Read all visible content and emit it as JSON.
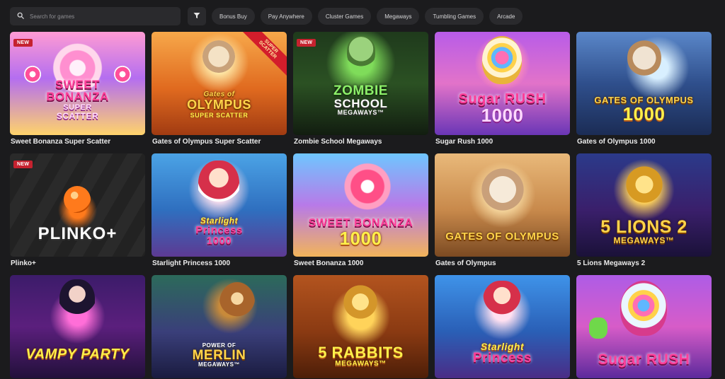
{
  "search": {
    "placeholder": "Search for games",
    "icon": "search-icon"
  },
  "filter": {
    "icon": "filter-icon"
  },
  "categories": [
    "Bonus Buy",
    "Pay Anywhere",
    "Cluster Games",
    "Megaways",
    "Tumbling Games",
    "Arcade"
  ],
  "games": [
    {
      "title": "Sweet Bonanza Super Scatter",
      "badge": "NEW",
      "logo_lines": [
        "SWEET",
        "BONANZA",
        "SUPER",
        "SCATTER"
      ]
    },
    {
      "title": "Gates of Olympus Super Scatter",
      "ribbon_lines": [
        "SUPER",
        "SCATTER"
      ],
      "logo_lines": [
        "Gates of",
        "OLYMPUS",
        "SUPER SCATTER"
      ]
    },
    {
      "title": "Zombie School Megaways",
      "badge": "NEW",
      "logo_lines": [
        "ZOMBIE",
        "SCHOOL",
        "MEGAWAYS™"
      ]
    },
    {
      "title": "Sugar Rush 1000",
      "logo_lines": [
        "Sugar RUSH",
        "1000"
      ]
    },
    {
      "title": "Gates of Olympus 1000",
      "logo_lines": [
        "GATES OF OLYMPUS",
        "1000"
      ]
    },
    {
      "title": "Plinko+",
      "badge": "NEW",
      "logo_lines": [
        "PLINKO+"
      ]
    },
    {
      "title": "Starlight Princess 1000",
      "logo_lines": [
        "Starlight",
        "Princess",
        "1000"
      ]
    },
    {
      "title": "Sweet Bonanza 1000",
      "logo_lines": [
        "SWEET BONANZA",
        "1000"
      ]
    },
    {
      "title": "Gates of Olympus",
      "logo_lines": [
        "GATES OF OLYMPUS"
      ]
    },
    {
      "title": "5 Lions Megaways 2",
      "logo_lines": [
        "5 LIONS 2",
        "MEGAWAYS™"
      ]
    },
    {
      "title": "",
      "logo_lines": [
        "VAMPY PARTY"
      ]
    },
    {
      "title": "",
      "logo_lines": [
        "POWER OF",
        "MERLIN",
        "MEGAWAYS™"
      ]
    },
    {
      "title": "",
      "logo_lines": [
        "5 RABBITS",
        "MEGAWAYS™"
      ]
    },
    {
      "title": "",
      "logo_lines": [
        "Starlight",
        "Princess"
      ]
    },
    {
      "title": "",
      "logo_lines": [
        "Sugar RUSH"
      ]
    }
  ],
  "colors": {
    "background": "#1b1b1d",
    "chip": "#2a2a2d",
    "badge_new": "#c5222f"
  }
}
